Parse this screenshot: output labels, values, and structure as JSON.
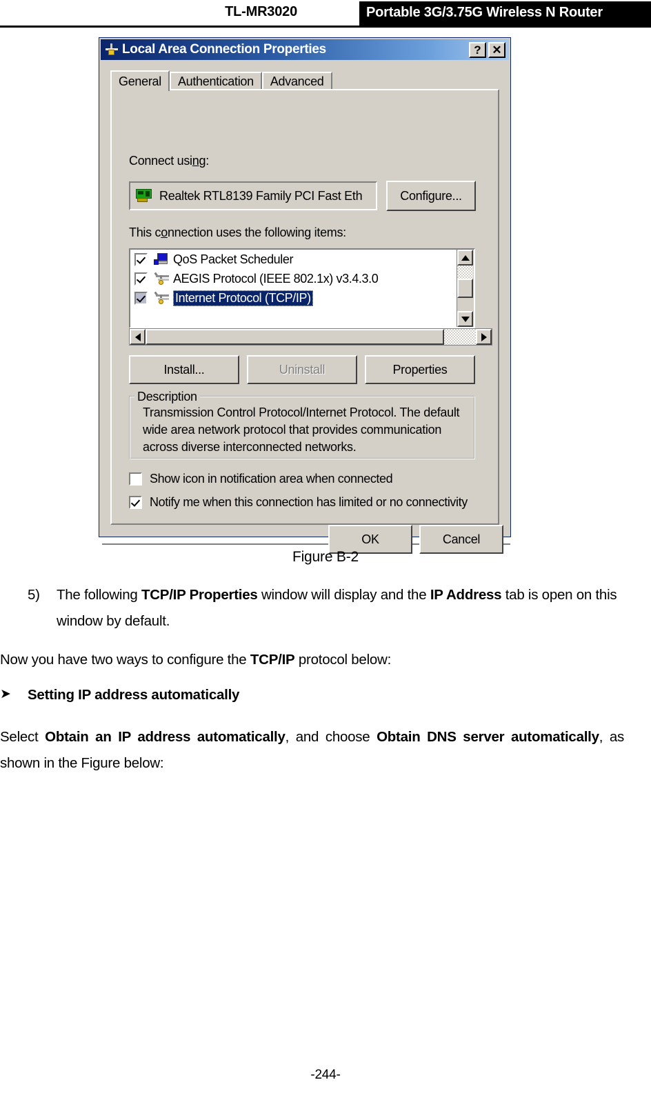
{
  "header": {
    "model": "TL-MR3020",
    "product": "Portable 3G/3.75G Wireless N Router"
  },
  "dialog": {
    "title": "Local Area Connection   Properties",
    "title_icon": "network-plug-icon",
    "help_button": "?",
    "close_button": "✕",
    "tabs": [
      {
        "label": "General",
        "active": true
      },
      {
        "label": "Authentication",
        "active": false
      },
      {
        "label": "Advanced",
        "active": false
      }
    ],
    "connect_using_label": "Connect using:",
    "adapter": {
      "icon": "network-card-icon",
      "name": "Realtek RTL8139 Family PCI Fast Eth"
    },
    "configure_button": "Configure...",
    "items_label": "This connection uses the following items:",
    "items": [
      {
        "label": "QoS Packet Scheduler",
        "checked": true,
        "selected": false,
        "icon": "monitor-icon"
      },
      {
        "label": "AEGIS Protocol (IEEE 802.1x) v3.4.3.0",
        "checked": true,
        "selected": false,
        "icon": "protocol-icon"
      },
      {
        "label": "Internet Protocol (TCP/IP)",
        "checked": true,
        "selected": true,
        "icon": "protocol-icon"
      }
    ],
    "buttons": {
      "install": "Install...",
      "uninstall": "Uninstall",
      "properties": "Properties"
    },
    "description": {
      "title": "Description",
      "lines": [
        "Transmission Control Protocol/Internet Protocol. The default",
        "wide area network protocol that provides communication",
        "across diverse interconnected networks."
      ]
    },
    "checkboxes": [
      {
        "label": "Show icon in notification area when connected",
        "checked": false
      },
      {
        "label": "Notify me when this connection has limited or no connectivity",
        "checked": true
      }
    ],
    "ok_button": "OK",
    "cancel_button": "Cancel"
  },
  "figure_caption": "Figure B-2",
  "step": {
    "marker": "5)",
    "part1": "The following ",
    "bold1": "TCP/IP Properties",
    "part2": " window will display and the ",
    "bold2": "IP Address",
    "part3": " tab is open on this window by default."
  },
  "paragraph_ways": {
    "part1": "Now you have two ways to configure the ",
    "bold1": "TCP/IP",
    "part2": " protocol below:"
  },
  "bullet": {
    "glyph": "➤",
    "label": "Setting IP address automatically"
  },
  "paragraph_select": {
    "part1": "Select ",
    "bold1": "Obtain an IP address automatically",
    "part2": ", and choose ",
    "bold2": "Obtain DNS server automatically",
    "part3": ", as shown in the Figure below:"
  },
  "footer": "-244-"
}
